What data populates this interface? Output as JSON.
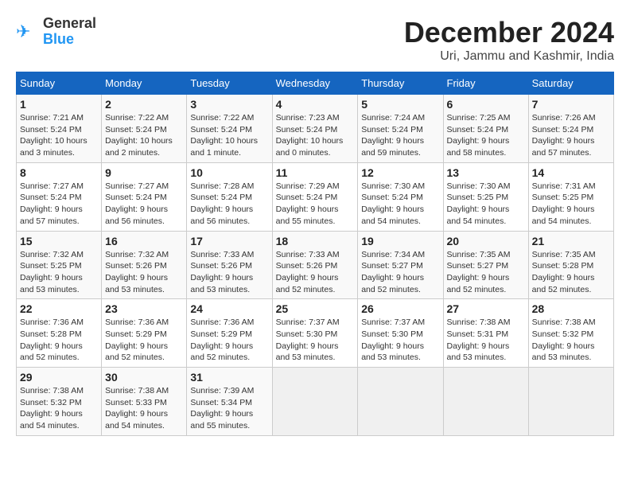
{
  "header": {
    "logo_line1": "General",
    "logo_line2": "Blue",
    "month_title": "December 2024",
    "location": "Uri, Jammu and Kashmir, India"
  },
  "calendar": {
    "days_of_week": [
      "Sunday",
      "Monday",
      "Tuesday",
      "Wednesday",
      "Thursday",
      "Friday",
      "Saturday"
    ],
    "weeks": [
      [
        {
          "day": "1",
          "info": "Sunrise: 7:21 AM\nSunset: 5:24 PM\nDaylight: 10 hours\nand 3 minutes."
        },
        {
          "day": "2",
          "info": "Sunrise: 7:22 AM\nSunset: 5:24 PM\nDaylight: 10 hours\nand 2 minutes."
        },
        {
          "day": "3",
          "info": "Sunrise: 7:22 AM\nSunset: 5:24 PM\nDaylight: 10 hours\nand 1 minute."
        },
        {
          "day": "4",
          "info": "Sunrise: 7:23 AM\nSunset: 5:24 PM\nDaylight: 10 hours\nand 0 minutes."
        },
        {
          "day": "5",
          "info": "Sunrise: 7:24 AM\nSunset: 5:24 PM\nDaylight: 9 hours\nand 59 minutes."
        },
        {
          "day": "6",
          "info": "Sunrise: 7:25 AM\nSunset: 5:24 PM\nDaylight: 9 hours\nand 58 minutes."
        },
        {
          "day": "7",
          "info": "Sunrise: 7:26 AM\nSunset: 5:24 PM\nDaylight: 9 hours\nand 57 minutes."
        }
      ],
      [
        {
          "day": "8",
          "info": "Sunrise: 7:27 AM\nSunset: 5:24 PM\nDaylight: 9 hours\nand 57 minutes."
        },
        {
          "day": "9",
          "info": "Sunrise: 7:27 AM\nSunset: 5:24 PM\nDaylight: 9 hours\nand 56 minutes."
        },
        {
          "day": "10",
          "info": "Sunrise: 7:28 AM\nSunset: 5:24 PM\nDaylight: 9 hours\nand 56 minutes."
        },
        {
          "day": "11",
          "info": "Sunrise: 7:29 AM\nSunset: 5:24 PM\nDaylight: 9 hours\nand 55 minutes."
        },
        {
          "day": "12",
          "info": "Sunrise: 7:30 AM\nSunset: 5:24 PM\nDaylight: 9 hours\nand 54 minutes."
        },
        {
          "day": "13",
          "info": "Sunrise: 7:30 AM\nSunset: 5:25 PM\nDaylight: 9 hours\nand 54 minutes."
        },
        {
          "day": "14",
          "info": "Sunrise: 7:31 AM\nSunset: 5:25 PM\nDaylight: 9 hours\nand 54 minutes."
        }
      ],
      [
        {
          "day": "15",
          "info": "Sunrise: 7:32 AM\nSunset: 5:25 PM\nDaylight: 9 hours\nand 53 minutes."
        },
        {
          "day": "16",
          "info": "Sunrise: 7:32 AM\nSunset: 5:26 PM\nDaylight: 9 hours\nand 53 minutes."
        },
        {
          "day": "17",
          "info": "Sunrise: 7:33 AM\nSunset: 5:26 PM\nDaylight: 9 hours\nand 53 minutes."
        },
        {
          "day": "18",
          "info": "Sunrise: 7:33 AM\nSunset: 5:26 PM\nDaylight: 9 hours\nand 52 minutes."
        },
        {
          "day": "19",
          "info": "Sunrise: 7:34 AM\nSunset: 5:27 PM\nDaylight: 9 hours\nand 52 minutes."
        },
        {
          "day": "20",
          "info": "Sunrise: 7:35 AM\nSunset: 5:27 PM\nDaylight: 9 hours\nand 52 minutes."
        },
        {
          "day": "21",
          "info": "Sunrise: 7:35 AM\nSunset: 5:28 PM\nDaylight: 9 hours\nand 52 minutes."
        }
      ],
      [
        {
          "day": "22",
          "info": "Sunrise: 7:36 AM\nSunset: 5:28 PM\nDaylight: 9 hours\nand 52 minutes."
        },
        {
          "day": "23",
          "info": "Sunrise: 7:36 AM\nSunset: 5:29 PM\nDaylight: 9 hours\nand 52 minutes."
        },
        {
          "day": "24",
          "info": "Sunrise: 7:36 AM\nSunset: 5:29 PM\nDaylight: 9 hours\nand 52 minutes."
        },
        {
          "day": "25",
          "info": "Sunrise: 7:37 AM\nSunset: 5:30 PM\nDaylight: 9 hours\nand 53 minutes."
        },
        {
          "day": "26",
          "info": "Sunrise: 7:37 AM\nSunset: 5:30 PM\nDaylight: 9 hours\nand 53 minutes."
        },
        {
          "day": "27",
          "info": "Sunrise: 7:38 AM\nSunset: 5:31 PM\nDaylight: 9 hours\nand 53 minutes."
        },
        {
          "day": "28",
          "info": "Sunrise: 7:38 AM\nSunset: 5:32 PM\nDaylight: 9 hours\nand 53 minutes."
        }
      ],
      [
        {
          "day": "29",
          "info": "Sunrise: 7:38 AM\nSunset: 5:32 PM\nDaylight: 9 hours\nand 54 minutes."
        },
        {
          "day": "30",
          "info": "Sunrise: 7:38 AM\nSunset: 5:33 PM\nDaylight: 9 hours\nand 54 minutes."
        },
        {
          "day": "31",
          "info": "Sunrise: 7:39 AM\nSunset: 5:34 PM\nDaylight: 9 hours\nand 55 minutes."
        },
        {
          "day": "",
          "info": ""
        },
        {
          "day": "",
          "info": ""
        },
        {
          "day": "",
          "info": ""
        },
        {
          "day": "",
          "info": ""
        }
      ]
    ]
  }
}
